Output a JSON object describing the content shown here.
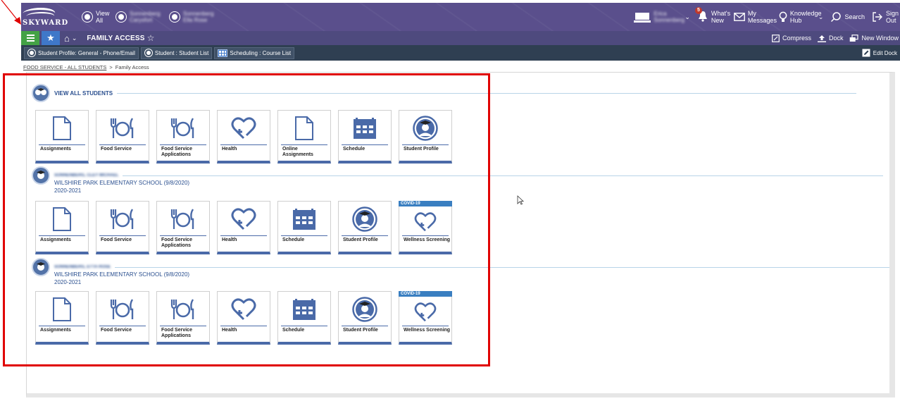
{
  "top_bar": {
    "logo_text": "SKYWARD",
    "view_all_label": "View All",
    "student1_blurred": "Sonnenberg Carysfort",
    "student2_blurred": "Sonnenberg Ella Rose",
    "user_blurred": "Erica Sonnenberg",
    "whats_new_label": "What's New",
    "whats_new_count": "5",
    "messages_label": "My Messages",
    "knowledge_label": "Knowledge Hub",
    "search_label": "Search",
    "signout_label": "Sign Out"
  },
  "nav_bar": {
    "page_title": "FAMILY ACCESS",
    "compress_label": "Compress",
    "dock_label": "Dock",
    "new_window_label": "New Window"
  },
  "dock_bar": {
    "tabs": [
      {
        "label": "Student Profile: General - Phone/Email"
      },
      {
        "label": "Student : Student List"
      },
      {
        "label": "Scheduling : Course List"
      }
    ],
    "edit_dock_label": "Edit Dock"
  },
  "breadcrumb": {
    "link": "FOOD SERVICE - ALL STUDENTS",
    "separator": ">",
    "current": "Family Access"
  },
  "sections": [
    {
      "title": "VIEW ALL STUDENTS",
      "tiles": [
        {
          "label": "Assignments",
          "icon": "document-icon"
        },
        {
          "label": "Food Service",
          "icon": "utensils-icon"
        },
        {
          "label": "Food Service Applications",
          "icon": "utensils-icon"
        },
        {
          "label": "Health",
          "icon": "heart-plus-icon"
        },
        {
          "label": "Online Assignments",
          "icon": "document-icon"
        },
        {
          "label": "Schedule",
          "icon": "calendar-icon"
        },
        {
          "label": "Student Profile",
          "icon": "student-icon"
        }
      ]
    },
    {
      "student_blurred": "SONNENBERG, CLEY MICHAEL",
      "school": "WILSHIRE PARK ELEMENTARY SCHOOL (9/8/2020)",
      "year": "2020-2021",
      "tiles": [
        {
          "label": "Assignments",
          "icon": "document-icon"
        },
        {
          "label": "Food Service",
          "icon": "utensils-icon"
        },
        {
          "label": "Food Service Applications",
          "icon": "utensils-icon"
        },
        {
          "label": "Health",
          "icon": "heart-plus-icon"
        },
        {
          "label": "Schedule",
          "icon": "calendar-icon"
        },
        {
          "label": "Student Profile",
          "icon": "student-icon"
        },
        {
          "label": "Wellness Screening",
          "icon": "heart-plus-icon",
          "banner": "COVID-19"
        }
      ]
    },
    {
      "student_blurred": "SONNENBERG, ETTA ROSE",
      "school": "WILSHIRE PARK ELEMENTARY SCHOOL (9/8/2020)",
      "year": "2020-2021",
      "tiles": [
        {
          "label": "Assignments",
          "icon": "document-icon"
        },
        {
          "label": "Food Service",
          "icon": "utensils-icon"
        },
        {
          "label": "Food Service Applications",
          "icon": "utensils-icon"
        },
        {
          "label": "Health",
          "icon": "heart-plus-icon"
        },
        {
          "label": "Schedule",
          "icon": "calendar-icon"
        },
        {
          "label": "Student Profile",
          "icon": "student-icon"
        },
        {
          "label": "Wellness Screening",
          "icon": "heart-plus-icon",
          "banner": "COVID-19"
        }
      ]
    }
  ],
  "colors": {
    "brand_purple": "#5a4f8c",
    "menu_green": "#44a246",
    "tile_accent": "#4a6aa8",
    "highlight_red": "#e00000"
  }
}
